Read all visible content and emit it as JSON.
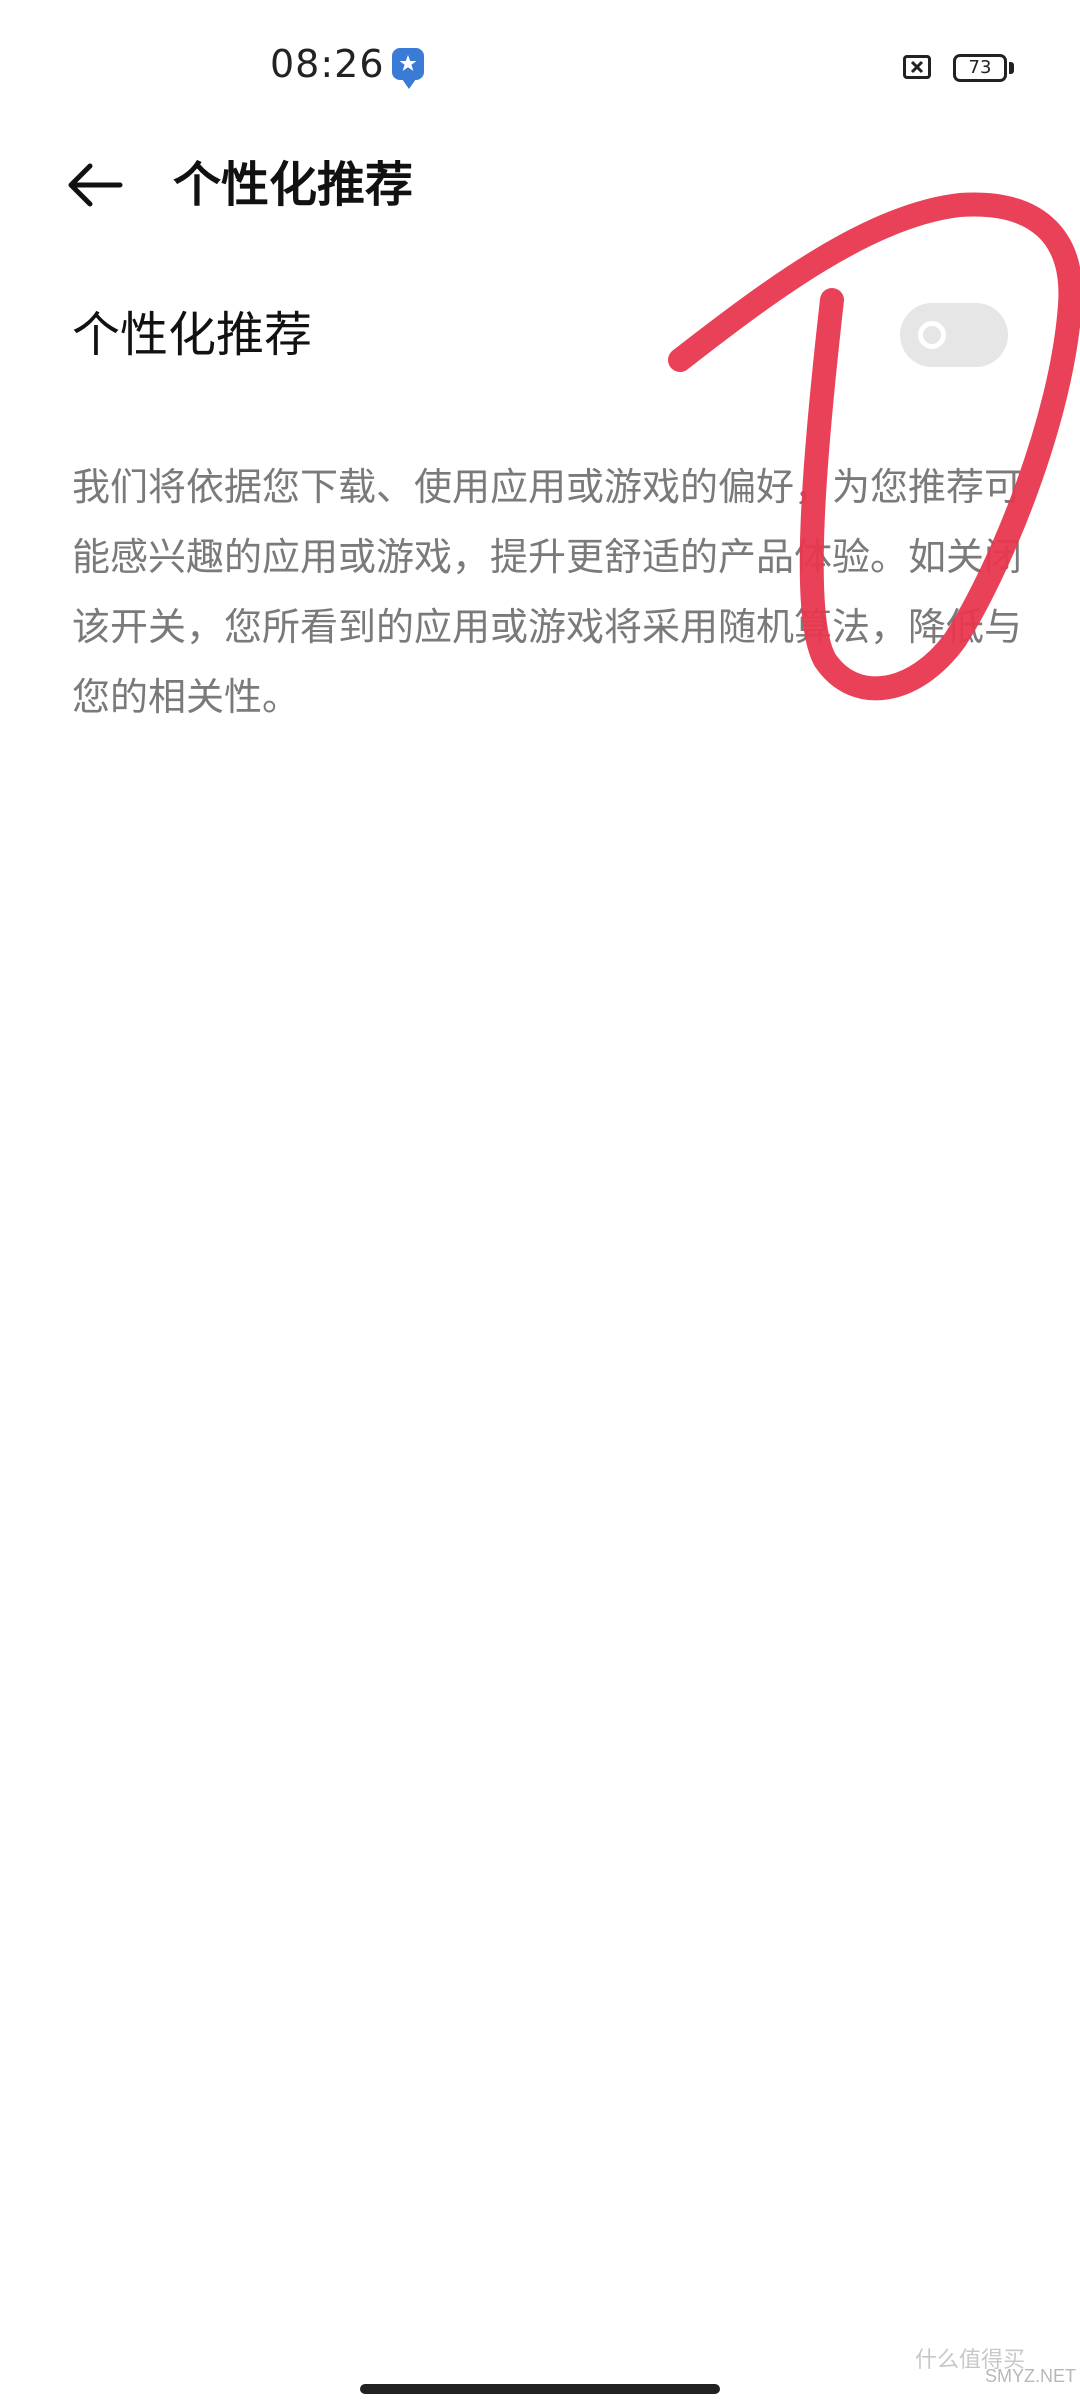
{
  "status_bar": {
    "time": "08:26",
    "battery_level": "73",
    "icons": [
      "app-notification-icon",
      "no-sim-icon",
      "battery-icon"
    ]
  },
  "header": {
    "title": "个性化推荐",
    "back_icon": "arrow-left-icon"
  },
  "setting": {
    "label": "个性化推荐",
    "toggle_state": "off"
  },
  "description": "我们将依据您下载、使用应用或游戏的偏好，为您推荐可能感兴趣的应用或游戏，提升更舒适的产品体验。如关闭该开关，您所看到的应用或游戏将采用随机算法，降低与您的相关性。",
  "watermark": {
    "text": "什么值得买",
    "sub": "SMYZ.NET"
  },
  "colors": {
    "annotation_stroke": "#e8384f",
    "toggle_off": "#e6e6e6",
    "description_text": "#7a7a7a",
    "app_icon": "#3a7bd5"
  }
}
